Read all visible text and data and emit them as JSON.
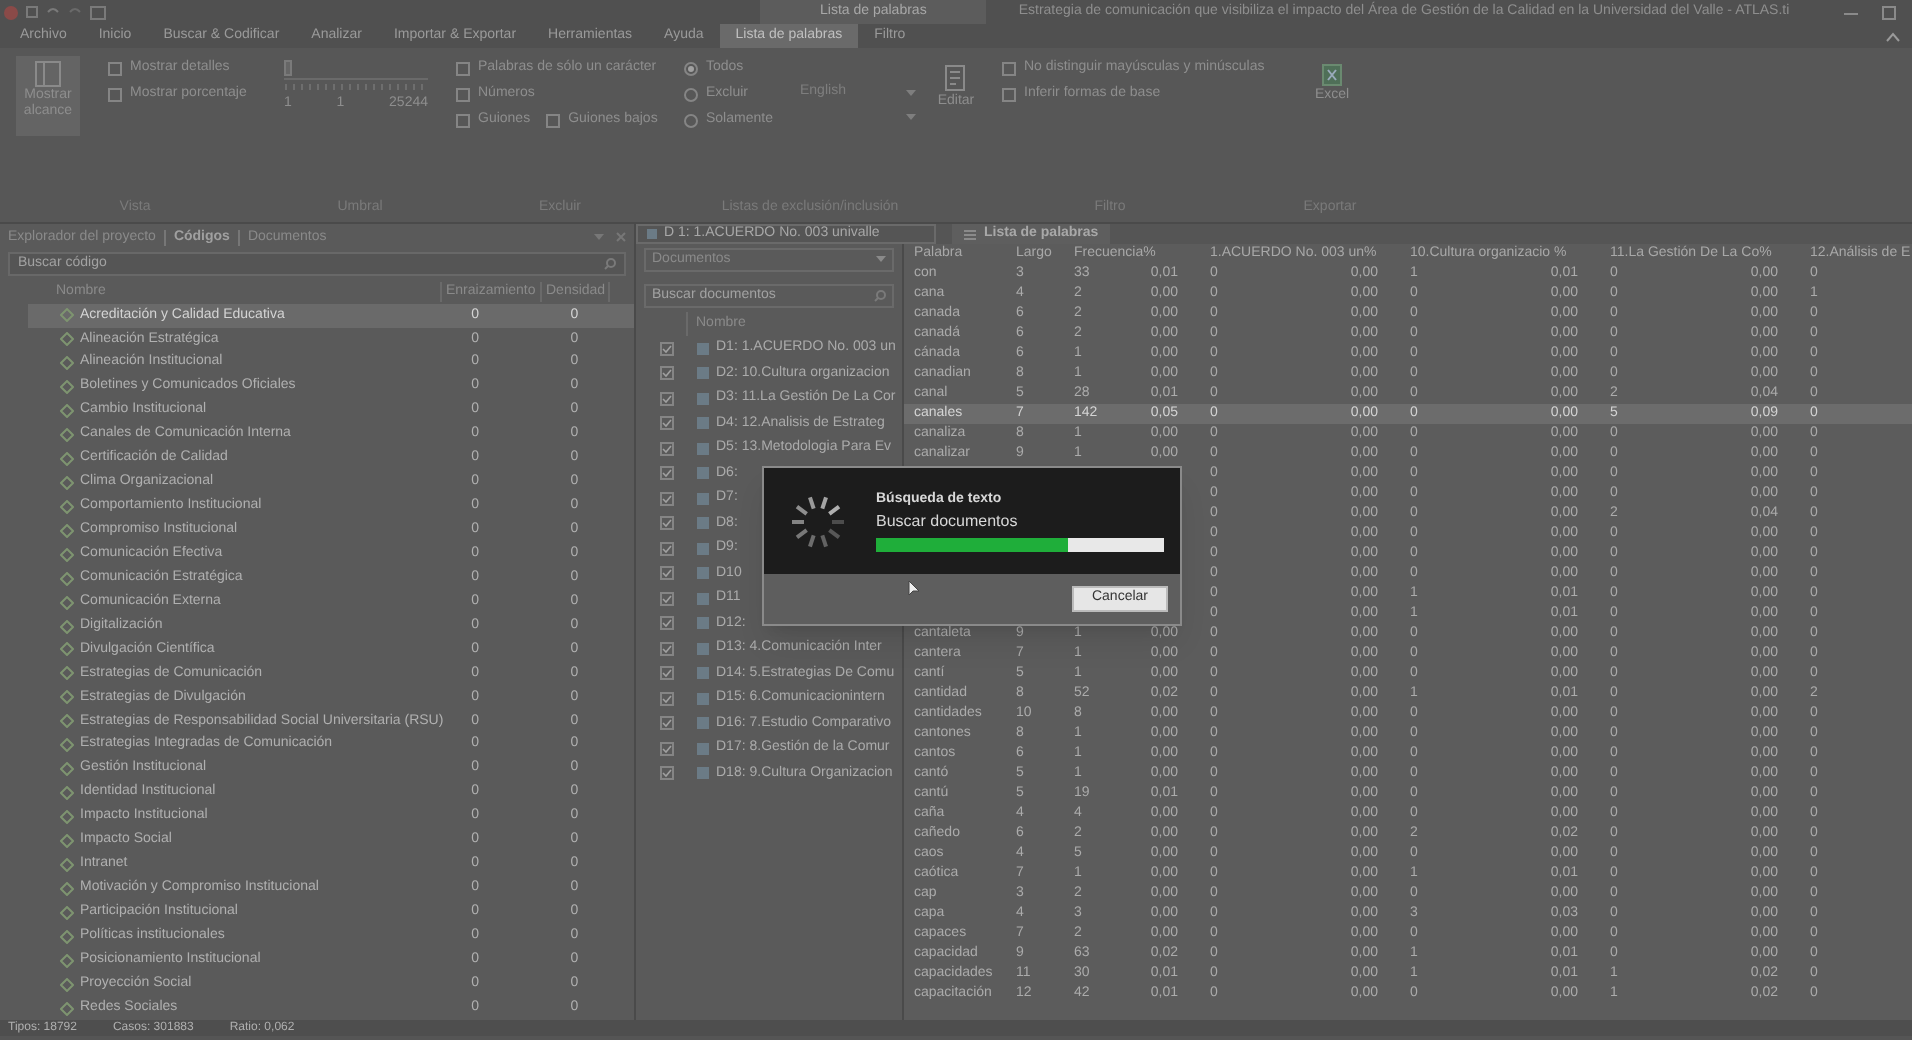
{
  "title_bar": {
    "context_tab": "Lista de palabras",
    "title": "Estrategia de comunicación que visibiliza el impacto del Área de Gestión de la Calidad en la Universidad del Valle - ATLAS.ti"
  },
  "menu": [
    {
      "label": "Archivo",
      "selected": false
    },
    {
      "label": "Inicio",
      "selected": false
    },
    {
      "label": "Buscar & Codificar",
      "selected": false
    },
    {
      "label": "Analizar",
      "selected": false
    },
    {
      "label": "Importar & Exportar",
      "selected": false
    },
    {
      "label": "Herramientas",
      "selected": false
    },
    {
      "label": "Ayuda",
      "selected": false
    },
    {
      "label": "Lista de palabras",
      "selected": true
    },
    {
      "label": "Filtro",
      "selected": false
    }
  ],
  "ribbon": {
    "show_scope": "Mostrar alcance",
    "view_options": [
      {
        "label": "Mostrar detalles",
        "checked": false
      },
      {
        "label": "Mostrar porcentaje",
        "checked": false
      }
    ],
    "threshold": {
      "level": 0,
      "labels": [
        "1",
        "1",
        "25244"
      ]
    },
    "exclude": [
      {
        "label": "Palabras de sólo un carácter",
        "checked": false
      },
      {
        "label": "Números",
        "checked": false
      },
      {
        "label": "Guiones",
        "checked": false
      },
      {
        "label": "Guiones bajos",
        "checked": false
      }
    ],
    "list_modes": [
      {
        "label": "Todos",
        "selected": true
      },
      {
        "label": "Excluir",
        "selected": false
      },
      {
        "label": "Solamente",
        "selected": false
      }
    ],
    "language": "English",
    "edit": "Editar",
    "filters": [
      {
        "label": "No distinguir mayúsculas y minúsculas",
        "checked": false
      },
      {
        "label": "Inferir formas de base",
        "checked": false
      }
    ],
    "excel": "Excel",
    "groups": [
      "Vista",
      "Umbral",
      "Excluir",
      "Listas de exclusión/inclusión",
      "Filtro",
      "Exportar"
    ]
  },
  "explorer": {
    "tabs": [
      {
        "label": "Explorador del proyecto",
        "selected": false
      },
      {
        "label": "Códigos",
        "selected": true
      },
      {
        "label": "Documentos",
        "selected": false
      }
    ],
    "search": {
      "placeholder": "Buscar código"
    },
    "columns": [
      "Nombre",
      "Enraizamiento",
      "Densidad"
    ],
    "codes": [
      {
        "name": "Acreditación y Calidad Educativa",
        "grounded": "0",
        "density": "0",
        "selected": true
      },
      {
        "name": "Alineación Estratégica",
        "grounded": "0",
        "density": "0",
        "selected": false
      },
      {
        "name": "Alineación Institucional",
        "grounded": "0",
        "density": "0",
        "selected": false
      },
      {
        "name": "Boletines y Comunicados Oficiales",
        "grounded": "0",
        "density": "0",
        "selected": false
      },
      {
        "name": "Cambio Institucional",
        "grounded": "0",
        "density": "0",
        "selected": false
      },
      {
        "name": "Canales de Comunicación Interna",
        "grounded": "0",
        "density": "0",
        "selected": false
      },
      {
        "name": "Certificación de Calidad",
        "grounded": "0",
        "density": "0",
        "selected": false
      },
      {
        "name": "Clima Organizacional",
        "grounded": "0",
        "density": "0",
        "selected": false
      },
      {
        "name": "Comportamiento Institucional",
        "grounded": "0",
        "density": "0",
        "selected": false
      },
      {
        "name": "Compromiso Institucional",
        "grounded": "0",
        "density": "0",
        "selected": false
      },
      {
        "name": "Comunicación Efectiva",
        "grounded": "0",
        "density": "0",
        "selected": false
      },
      {
        "name": "Comunicación Estratégica",
        "grounded": "0",
        "density": "0",
        "selected": false
      },
      {
        "name": "Comunicación Externa",
        "grounded": "0",
        "density": "0",
        "selected": false
      },
      {
        "name": "Digitalización",
        "grounded": "0",
        "density": "0",
        "selected": false
      },
      {
        "name": "Divulgación Científica",
        "grounded": "0",
        "density": "0",
        "selected": false
      },
      {
        "name": "Estrategias de Comunicación",
        "grounded": "0",
        "density": "0",
        "selected": false
      },
      {
        "name": "Estrategias de Divulgación",
        "grounded": "0",
        "density": "0",
        "selected": false
      },
      {
        "name": "Estrategias de Responsabilidad Social Universitaria (RSU)",
        "grounded": "0",
        "density": "0",
        "selected": false
      },
      {
        "name": "Estrategias Integradas de Comunicación",
        "grounded": "0",
        "density": "0",
        "selected": false
      },
      {
        "name": "Gestión Institucional",
        "grounded": "0",
        "density": "0",
        "selected": false
      },
      {
        "name": "Identidad Institucional",
        "grounded": "0",
        "density": "0",
        "selected": false
      },
      {
        "name": "Impacto Institucional",
        "grounded": "0",
        "density": "0",
        "selected": false
      },
      {
        "name": "Impacto Social",
        "grounded": "0",
        "density": "0",
        "selected": false
      },
      {
        "name": "Intranet",
        "grounded": "0",
        "density": "0",
        "selected": false
      },
      {
        "name": "Motivación y Compromiso Institucional",
        "grounded": "0",
        "density": "0",
        "selected": false
      },
      {
        "name": "Participación Institucional",
        "grounded": "0",
        "density": "0",
        "selected": false
      },
      {
        "name": "Políticas institucionales",
        "grounded": "0",
        "density": "0",
        "selected": false
      },
      {
        "name": "Posicionamiento Institucional",
        "grounded": "0",
        "density": "0",
        "selected": false
      },
      {
        "name": "Proyección Social",
        "grounded": "0",
        "density": "0",
        "selected": false
      },
      {
        "name": "Redes Sociales",
        "grounded": "0",
        "density": "0",
        "selected": false
      }
    ]
  },
  "document_tab": "D 1: 1.ACUERDO No. 003 univalle",
  "documents": {
    "scope": "Documentos",
    "search": {
      "placeholder": "Buscar documentos"
    },
    "column": "Nombre",
    "items": [
      {
        "name": "D1: 1.ACUERDO No. 003 un",
        "checked": true
      },
      {
        "name": "D2: 10.Cultura organizacion",
        "checked": true
      },
      {
        "name": "D3: 11.La Gestión De La Cor",
        "checked": true
      },
      {
        "name": "D4: 12.Analisis de Estrateg",
        "checked": true
      },
      {
        "name": "D5: 13.Metodologia Para Ev",
        "checked": true
      },
      {
        "name": "D6:",
        "checked": true
      },
      {
        "name": "D7:",
        "checked": true
      },
      {
        "name": "D8:",
        "checked": true
      },
      {
        "name": "D9:",
        "checked": true
      },
      {
        "name": "D10",
        "checked": true
      },
      {
        "name": "D11",
        "checked": true
      },
      {
        "name": "D12:",
        "checked": true
      },
      {
        "name": "D13: 4.Comunicación Inter",
        "checked": true
      },
      {
        "name": "D14: 5.Estrategias De Comu",
        "checked": true
      },
      {
        "name": "D15: 6.Comunicacionintern",
        "checked": true
      },
      {
        "name": "D16: 7.Estudio Comparativo",
        "checked": true
      },
      {
        "name": "D17: 8.Gestión de la Comur",
        "checked": true
      },
      {
        "name": "D18: 9.Cultura Organizacion",
        "checked": true
      }
    ]
  },
  "word_list": {
    "tab": "Lista de palabras",
    "columns": [
      "Palabra",
      "Largo",
      "Frecuencia%",
      "1.ACUERDO No. 003 un%",
      "10.Cultura organizacio %",
      "11.La Gestión De La Co%",
      "12.Análisis de E"
    ],
    "rows": [
      {
        "cells": [
          "con",
          "3",
          [
            "33",
            "0,01"
          ],
          [
            "0",
            "0,00"
          ],
          [
            "1",
            "0,01"
          ],
          [
            "0",
            "0,00"
          ],
          "0"
        ],
        "selected": false
      },
      {
        "cells": [
          "cana",
          "4",
          [
            "2",
            "0,00"
          ],
          [
            "0",
            "0,00"
          ],
          [
            "0",
            "0,00"
          ],
          [
            "0",
            "0,00"
          ],
          "1"
        ],
        "selected": false
      },
      {
        "cells": [
          "canada",
          "6",
          [
            "2",
            "0,00"
          ],
          [
            "0",
            "0,00"
          ],
          [
            "0",
            "0,00"
          ],
          [
            "0",
            "0,00"
          ],
          "0"
        ],
        "selected": false
      },
      {
        "cells": [
          "canadá",
          "6",
          [
            "2",
            "0,00"
          ],
          [
            "0",
            "0,00"
          ],
          [
            "0",
            "0,00"
          ],
          [
            "0",
            "0,00"
          ],
          "0"
        ],
        "selected": false
      },
      {
        "cells": [
          "cánada",
          "6",
          [
            "1",
            "0,00"
          ],
          [
            "0",
            "0,00"
          ],
          [
            "0",
            "0,00"
          ],
          [
            "0",
            "0,00"
          ],
          "0"
        ],
        "selected": false
      },
      {
        "cells": [
          "canadian",
          "8",
          [
            "1",
            "0,00"
          ],
          [
            "0",
            "0,00"
          ],
          [
            "0",
            "0,00"
          ],
          [
            "0",
            "0,00"
          ],
          "0"
        ],
        "selected": false
      },
      {
        "cells": [
          "canal",
          "5",
          [
            "28",
            "0,01"
          ],
          [
            "0",
            "0,00"
          ],
          [
            "0",
            "0,00"
          ],
          [
            "2",
            "0,04"
          ],
          "0"
        ],
        "selected": false
      },
      {
        "cells": [
          "canales",
          "7",
          [
            "142",
            "0,05"
          ],
          [
            "0",
            "0,00"
          ],
          [
            "0",
            "0,00"
          ],
          [
            "5",
            "0,09"
          ],
          "0"
        ],
        "selected": true
      },
      {
        "cells": [
          "canaliza",
          "8",
          [
            "1",
            "0,00"
          ],
          [
            "0",
            "0,00"
          ],
          [
            "0",
            "0,00"
          ],
          [
            "0",
            "0,00"
          ],
          "0"
        ],
        "selected": false
      },
      {
        "cells": [
          "canalizar",
          "9",
          [
            "1",
            "0,00"
          ],
          [
            "0",
            "0,00"
          ],
          [
            "0",
            "0,00"
          ],
          [
            "0",
            "0,00"
          ],
          "0"
        ],
        "selected": false
      },
      {
        "cells": [
          null,
          null,
          null,
          [
            "0",
            "0,00"
          ],
          [
            "0",
            "0,00"
          ],
          [
            "0",
            "0,00"
          ],
          "0"
        ],
        "selected": false
      },
      {
        "cells": [
          null,
          null,
          null,
          [
            "0",
            "0,00"
          ],
          [
            "0",
            "0,00"
          ],
          [
            "0",
            "0,00"
          ],
          "0"
        ],
        "selected": false
      },
      {
        "cells": [
          null,
          null,
          null,
          [
            "0",
            "0,00"
          ],
          [
            "0",
            "0,00"
          ],
          [
            "2",
            "0,04"
          ],
          "0"
        ],
        "selected": false
      },
      {
        "cells": [
          null,
          null,
          null,
          [
            "0",
            "0,00"
          ],
          [
            "0",
            "0,00"
          ],
          [
            "0",
            "0,00"
          ],
          "0"
        ],
        "selected": false
      },
      {
        "cells": [
          null,
          null,
          null,
          [
            "0",
            "0,00"
          ],
          [
            "0",
            "0,00"
          ],
          [
            "0",
            "0,00"
          ],
          "0"
        ],
        "selected": false
      },
      {
        "cells": [
          null,
          null,
          null,
          [
            "0",
            "0,00"
          ],
          [
            "0",
            "0,00"
          ],
          [
            "0",
            "0,00"
          ],
          "0"
        ],
        "selected": false
      },
      {
        "cells": [
          null,
          null,
          null,
          [
            "0",
            "0,00"
          ],
          [
            "1",
            "0,01"
          ],
          [
            "0",
            "0,00"
          ],
          "0"
        ],
        "selected": false
      },
      {
        "cells": [
          null,
          null,
          null,
          [
            "0",
            "0,00"
          ],
          [
            "1",
            "0,01"
          ],
          [
            "0",
            "0,00"
          ],
          "0"
        ],
        "selected": false
      },
      {
        "cells": [
          "cantaleta",
          "9",
          [
            "1",
            "0,00"
          ],
          [
            "0",
            "0,00"
          ],
          [
            "0",
            "0,00"
          ],
          [
            "0",
            "0,00"
          ],
          "0"
        ],
        "selected": false
      },
      {
        "cells": [
          "cantera",
          "7",
          [
            "1",
            "0,00"
          ],
          [
            "0",
            "0,00"
          ],
          [
            "0",
            "0,00"
          ],
          [
            "0",
            "0,00"
          ],
          "0"
        ],
        "selected": false
      },
      {
        "cells": [
          "cantí",
          "5",
          [
            "1",
            "0,00"
          ],
          [
            "0",
            "0,00"
          ],
          [
            "0",
            "0,00"
          ],
          [
            "0",
            "0,00"
          ],
          "0"
        ],
        "selected": false
      },
      {
        "cells": [
          "cantidad",
          "8",
          [
            "52",
            "0,02"
          ],
          [
            "0",
            "0,00"
          ],
          [
            "1",
            "0,01"
          ],
          [
            "0",
            "0,00"
          ],
          "2"
        ],
        "selected": false
      },
      {
        "cells": [
          "cantidades",
          "10",
          [
            "8",
            "0,00"
          ],
          [
            "0",
            "0,00"
          ],
          [
            "0",
            "0,00"
          ],
          [
            "0",
            "0,00"
          ],
          "0"
        ],
        "selected": false
      },
      {
        "cells": [
          "cantones",
          "8",
          [
            "1",
            "0,00"
          ],
          [
            "0",
            "0,00"
          ],
          [
            "0",
            "0,00"
          ],
          [
            "0",
            "0,00"
          ],
          "0"
        ],
        "selected": false
      },
      {
        "cells": [
          "cantos",
          "6",
          [
            "1",
            "0,00"
          ],
          [
            "0",
            "0,00"
          ],
          [
            "0",
            "0,00"
          ],
          [
            "0",
            "0,00"
          ],
          "0"
        ],
        "selected": false
      },
      {
        "cells": [
          "cantó",
          "5",
          [
            "1",
            "0,00"
          ],
          [
            "0",
            "0,00"
          ],
          [
            "0",
            "0,00"
          ],
          [
            "0",
            "0,00"
          ],
          "0"
        ],
        "selected": false
      },
      {
        "cells": [
          "cantú",
          "5",
          [
            "19",
            "0,01"
          ],
          [
            "0",
            "0,00"
          ],
          [
            "0",
            "0,00"
          ],
          [
            "0",
            "0,00"
          ],
          "0"
        ],
        "selected": false
      },
      {
        "cells": [
          "caña",
          "4",
          [
            "4",
            "0,00"
          ],
          [
            "0",
            "0,00"
          ],
          [
            "0",
            "0,00"
          ],
          [
            "0",
            "0,00"
          ],
          "0"
        ],
        "selected": false
      },
      {
        "cells": [
          "cañedo",
          "6",
          [
            "2",
            "0,00"
          ],
          [
            "0",
            "0,00"
          ],
          [
            "2",
            "0,02"
          ],
          [
            "0",
            "0,00"
          ],
          "0"
        ],
        "selected": false
      },
      {
        "cells": [
          "caos",
          "4",
          [
            "5",
            "0,00"
          ],
          [
            "0",
            "0,00"
          ],
          [
            "0",
            "0,00"
          ],
          [
            "0",
            "0,00"
          ],
          "0"
        ],
        "selected": false
      },
      {
        "cells": [
          "caótica",
          "7",
          [
            "1",
            "0,00"
          ],
          [
            "0",
            "0,00"
          ],
          [
            "1",
            "0,01"
          ],
          [
            "0",
            "0,00"
          ],
          "0"
        ],
        "selected": false
      },
      {
        "cells": [
          "cap",
          "3",
          [
            "2",
            "0,00"
          ],
          [
            "0",
            "0,00"
          ],
          [
            "0",
            "0,00"
          ],
          [
            "0",
            "0,00"
          ],
          "0"
        ],
        "selected": false
      },
      {
        "cells": [
          "capa",
          "4",
          [
            "3",
            "0,00"
          ],
          [
            "0",
            "0,00"
          ],
          [
            "3",
            "0,03"
          ],
          [
            "0",
            "0,00"
          ],
          "0"
        ],
        "selected": false
      },
      {
        "cells": [
          "capaces",
          "7",
          [
            "2",
            "0,00"
          ],
          [
            "0",
            "0,00"
          ],
          [
            "0",
            "0,00"
          ],
          [
            "0",
            "0,00"
          ],
          "0"
        ],
        "selected": false
      },
      {
        "cells": [
          "capacidad",
          "9",
          [
            "63",
            "0,02"
          ],
          [
            "0",
            "0,00"
          ],
          [
            "1",
            "0,01"
          ],
          [
            "0",
            "0,00"
          ],
          "0"
        ],
        "selected": false
      },
      {
        "cells": [
          "capacidades",
          "11",
          [
            "30",
            "0,01"
          ],
          [
            "0",
            "0,00"
          ],
          [
            "1",
            "0,01"
          ],
          [
            "1",
            "0,02"
          ],
          "0"
        ],
        "selected": false
      },
      {
        "cells": [
          "capacitación",
          "12",
          [
            "42",
            "0,01"
          ],
          [
            "0",
            "0,00"
          ],
          [
            "0",
            "0,00"
          ],
          [
            "1",
            "0,02"
          ],
          "0"
        ],
        "selected": false
      }
    ]
  },
  "progress_dialog": {
    "title": "Búsqueda de texto",
    "message": "Buscar documentos",
    "level": 0.67,
    "cancel": "Cancelar"
  },
  "status_bar": [
    "Tipos: 18792",
    "Casos: 301883",
    "Ratio: 0,062"
  ]
}
